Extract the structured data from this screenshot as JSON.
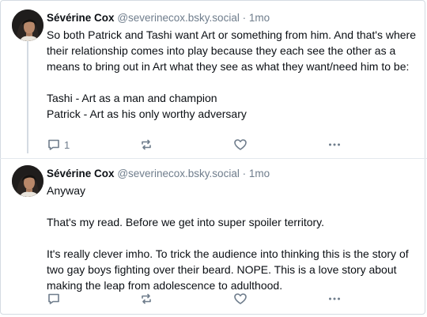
{
  "colors": {
    "text": "#0b0f14",
    "muted": "#6f7d8c",
    "border": "#d4dbe2"
  },
  "posts": [
    {
      "author": "Sévérine Cox",
      "handle": "@severinecox.bsky.social",
      "separator": "·",
      "time": "1mo",
      "lines": [
        "So both Patrick and Tashi want Art or something from him. And that's where their relationship comes into play because they each see the other as a means to bring out in Art what they see as what they want/need him to be:",
        "Tashi - Art as a man and champion",
        "Patrick - Art as his only worthy adversary"
      ],
      "reply_count": "1",
      "icons": [
        "reply-icon",
        "repost-icon",
        "like-icon",
        "more-icon"
      ]
    },
    {
      "author": "Sévérine Cox",
      "handle": "@severinecox.bsky.social",
      "separator": "·",
      "time": "1mo",
      "lines": [
        "Anyway",
        "That's my read. Before we get into super spoiler territory.",
        "It's really clever imho. To trick the audience into thinking this is the story of two gay boys fighting over their beard. NOPE. This is a love story about making the leap from adolescence to adulthood."
      ],
      "reply_count": "",
      "icons": [
        "reply-icon",
        "repost-icon",
        "like-icon",
        "more-icon"
      ]
    }
  ]
}
